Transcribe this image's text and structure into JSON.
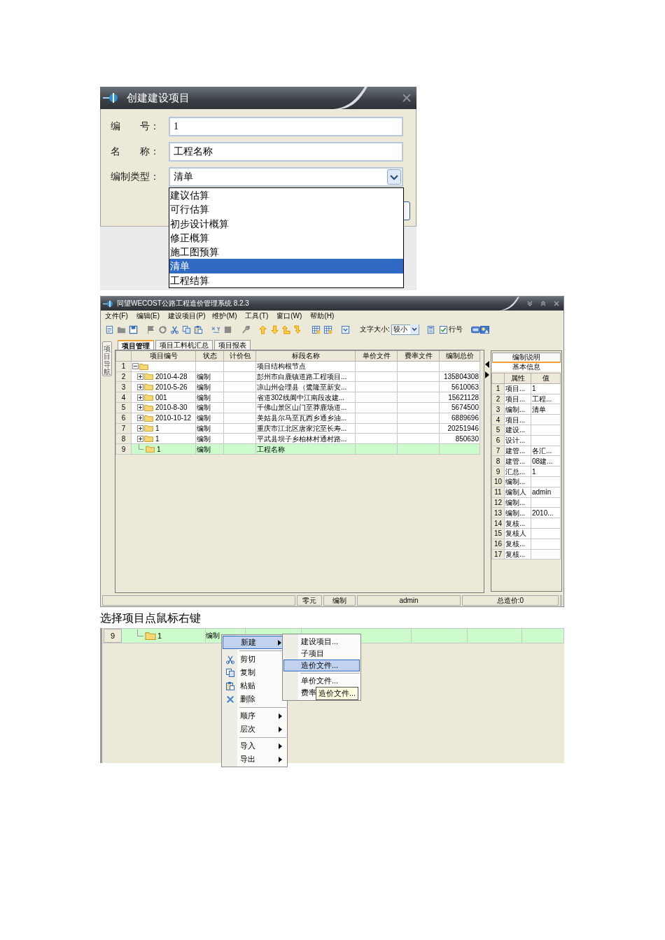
{
  "dialog": {
    "title": "创建建设项目",
    "fields": [
      {
        "label": "编　　号：",
        "value": "1",
        "kind": "text"
      },
      {
        "label": "名　　称：",
        "value": "工程名称",
        "kind": "text"
      },
      {
        "label": "编制类型：",
        "value": "清单",
        "kind": "select"
      }
    ],
    "options": [
      {
        "label": "建议估算",
        "selected": false
      },
      {
        "label": "可行估算",
        "selected": false
      },
      {
        "label": "初步设计概算",
        "selected": false
      },
      {
        "label": "修正概算",
        "selected": false
      },
      {
        "label": "施工图预算",
        "selected": false
      },
      {
        "label": "清单",
        "selected": true
      },
      {
        "label": "工程结算",
        "selected": false
      }
    ]
  },
  "main_window": {
    "title": "同望WECOST公路工程造价管理系统 8.2.3",
    "menu": [
      "文件(F)",
      "编辑(E)",
      "建设项目(P)",
      "维护(M)",
      "工具(T)",
      "窗口(W)",
      "帮助(H)"
    ],
    "toolbar": {
      "font_size_label": "文字大小:",
      "font_size_value": "较小",
      "row_numbers": {
        "label": "行号",
        "checked": true
      }
    },
    "side_tab": "项目导航",
    "tabs": [
      {
        "label": "项目管理",
        "selected": true
      },
      {
        "label": "项目工料机汇总",
        "selected": false
      },
      {
        "label": "项目报表",
        "selected": false
      }
    ],
    "table": {
      "columns": [
        "项目编号",
        "状态",
        "计价包",
        "标段名称",
        "单价文件",
        "费率文件",
        "编制总价"
      ],
      "rows": [
        {
          "num": "1",
          "kind": "root",
          "expanded": true,
          "name": "项目结构根节点",
          "selected": false
        },
        {
          "num": "2",
          "kind": "node",
          "expanded": false,
          "code": "2010-4-28",
          "status": "编制",
          "name": "彭州市白鹿镇道路工程项目...",
          "total": "135804308",
          "selected": false
        },
        {
          "num": "3",
          "kind": "node",
          "expanded": false,
          "code": "2010-5-26",
          "status": "编制",
          "name": "凉山州会理县（鹭隆至新安...",
          "total": "5610063",
          "selected": false
        },
        {
          "num": "4",
          "kind": "node",
          "expanded": false,
          "code": "001",
          "status": "编制",
          "name": "省道302线阆中江南段改建...",
          "total": "15621128",
          "selected": false
        },
        {
          "num": "5",
          "kind": "node",
          "expanded": false,
          "code": "2010-8-30",
          "status": "编制",
          "name": "千佛山景区山门至莽鹿场道...",
          "total": "5674500",
          "selected": false
        },
        {
          "num": "6",
          "kind": "node",
          "expanded": false,
          "code": "2010-10-12",
          "status": "编制",
          "name": "美姑县尔马至瓦西乡通乡油...",
          "total": "6889696",
          "selected": false
        },
        {
          "num": "7",
          "kind": "node",
          "expanded": false,
          "code": "1",
          "status": "编制",
          "name": "重庆市江北区唐家沱至长寿...",
          "total": "20251946",
          "selected": false
        },
        {
          "num": "8",
          "kind": "node",
          "expanded": false,
          "code": "1",
          "status": "编制",
          "name": "平武县坝子乡柏林村通村路...",
          "total": "850630",
          "selected": false
        },
        {
          "num": "9",
          "kind": "leaf",
          "code": "1",
          "status": "编制",
          "name": "工程名称",
          "selected": true
        }
      ]
    },
    "info_panel": {
      "header": "编制说明",
      "section": "基本信息",
      "columns": [
        "属性",
        "值"
      ],
      "rows": [
        {
          "num": "1",
          "attribute": "项目...",
          "value": "1"
        },
        {
          "num": "2",
          "attribute": "项目...",
          "value": "工程..."
        },
        {
          "num": "3",
          "attribute": "编制...",
          "value": "清单"
        },
        {
          "num": "4",
          "attribute": "项目..."
        },
        {
          "num": "5",
          "attribute": "建设..."
        },
        {
          "num": "6",
          "attribute": "设计..."
        },
        {
          "num": "7",
          "attribute": "建管...",
          "value": "各汇..."
        },
        {
          "num": "8",
          "attribute": "建管...",
          "value": "08建..."
        },
        {
          "num": "9",
          "attribute": "汇总...",
          "value": "1"
        },
        {
          "num": "10",
          "attribute": "编制..."
        },
        {
          "num": "11",
          "attribute": "编制人",
          "value": "admin"
        },
        {
          "num": "12",
          "attribute": "编制..."
        },
        {
          "num": "13",
          "attribute": "编制...",
          "value": "2010..."
        },
        {
          "num": "14",
          "attribute": "复核..."
        },
        {
          "num": "15",
          "attribute": "复核人"
        },
        {
          "num": "16",
          "attribute": "复核..."
        },
        {
          "num": "17",
          "attribute": "复核..."
        }
      ]
    },
    "status_bar": [
      "零元",
      "编制",
      "admin",
      "总造价:0"
    ]
  },
  "caption": "选择项目点鼠标右键",
  "context_view": {
    "row": {
      "num": "9",
      "code": "1",
      "status": "编制",
      "selected": true
    },
    "menu": [
      {
        "kind": "submenu",
        "label": "新建",
        "selected": true
      },
      {
        "kind": "separator"
      },
      {
        "kind": "command",
        "label": "剪切",
        "selected": false
      },
      {
        "kind": "command",
        "label": "复制",
        "selected": false
      },
      {
        "kind": "command",
        "label": "粘贴",
        "selected": false
      },
      {
        "kind": "command",
        "label": "删除",
        "selected": false
      },
      {
        "kind": "separator"
      },
      {
        "kind": "submenu",
        "label": "顺序",
        "selected": false
      },
      {
        "kind": "submenu",
        "label": "层次",
        "selected": false
      },
      {
        "kind": "separator"
      },
      {
        "kind": "submenu",
        "label": "导入",
        "selected": false
      },
      {
        "kind": "submenu",
        "label": "导出",
        "selected": false
      }
    ],
    "submenu": [
      {
        "kind": "command",
        "label": "建设项目...",
        "selected": false
      },
      {
        "kind": "command",
        "label": "子项目",
        "selected": false
      },
      {
        "kind": "command",
        "label": "造价文件...",
        "selected": true
      },
      {
        "kind": "separator"
      },
      {
        "kind": "command",
        "label": "单价文件...",
        "selected": false
      },
      {
        "kind": "command",
        "label": "费率",
        "selected": false
      }
    ],
    "tooltip": "造价文件..."
  }
}
